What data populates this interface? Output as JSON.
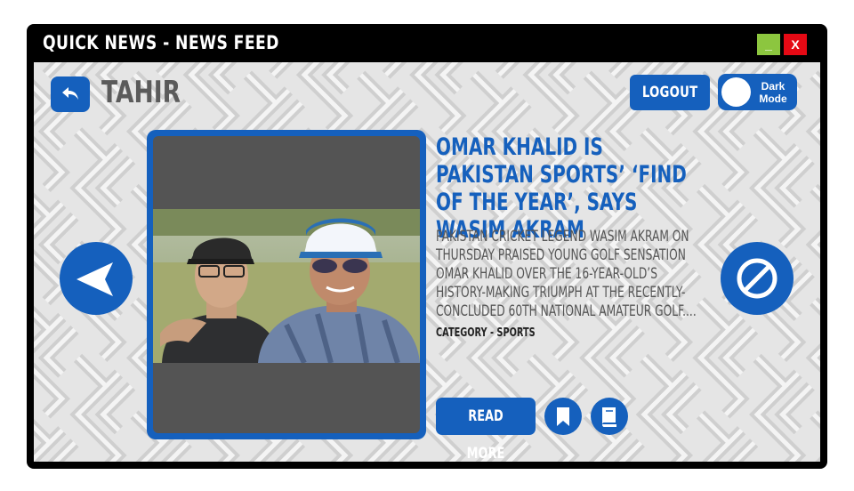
{
  "window": {
    "title": "Quick News - News Feed",
    "minimize_label": "_",
    "close_label": "X"
  },
  "header": {
    "username": "TAHIR",
    "logout_label": "LOGOUT",
    "dark_mode_label_line1": "Dark",
    "dark_mode_label_line2": "Mode"
  },
  "article": {
    "headline": "Omar Khalid is Pakistan Sports’ ‘Find of the Year’, says Wasim Akram",
    "summary": "Pakistan cricket legend Wasim Akram on Thursday praised young golf sensation Omar Khalid over the 16-year-old’s history-making triumph at the recently-concluded 60th National Amateur Golf....",
    "category": "Category - Sports",
    "read_more_label": "READ MORE"
  },
  "icons": {
    "back": "undo-arrow-icon",
    "previous": "left-arrow-icon",
    "block": "block-icon",
    "bookmark": "bookmark-icon",
    "book": "book-icon"
  },
  "colors": {
    "accent": "#1560bd",
    "titlebar": "#000000",
    "minimize": "#8cc63f",
    "close": "#e50914",
    "background": "#e5e5e5"
  }
}
